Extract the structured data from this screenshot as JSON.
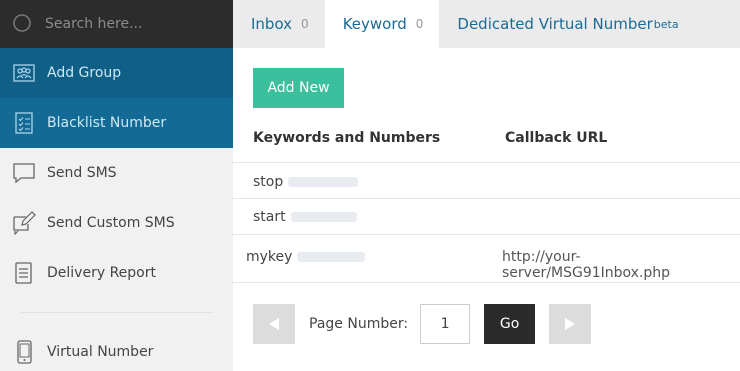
{
  "search": {
    "placeholder": "Search here..."
  },
  "sidebar": {
    "items": [
      {
        "label": "Add Group",
        "icon": "group-icon"
      },
      {
        "label": "Blacklist Number",
        "icon": "checklist-icon"
      },
      {
        "label": "Send SMS",
        "icon": "chat-bubble-icon"
      },
      {
        "label": "Send Custom SMS",
        "icon": "edit-message-icon"
      },
      {
        "label": "Delivery Report",
        "icon": "report-icon"
      },
      {
        "label": "Virtual Number",
        "icon": "phone-icon"
      }
    ]
  },
  "tabs": [
    {
      "label": "Inbox",
      "count": "0"
    },
    {
      "label": "Keyword",
      "count": "0"
    },
    {
      "label": "Dedicated Virtual Number",
      "suffix": "beta"
    }
  ],
  "main": {
    "add_button": "Add New",
    "columns": [
      "Keywords and Numbers",
      "Callback URL"
    ],
    "rows": [
      {
        "keyword": "stop",
        "callback": ""
      },
      {
        "keyword": "start",
        "callback": ""
      },
      {
        "keyword": "mykey",
        "callback": "http://your-server/MSG91Inbox.php"
      }
    ]
  },
  "pager": {
    "label": "Page Number:",
    "value": "1",
    "go": "Go"
  },
  "colors": {
    "accent": "#3bbf9c",
    "nav_active": "#0f5f86",
    "tab_text": "#1a6b95",
    "search_bg": "#2c2c2c"
  }
}
